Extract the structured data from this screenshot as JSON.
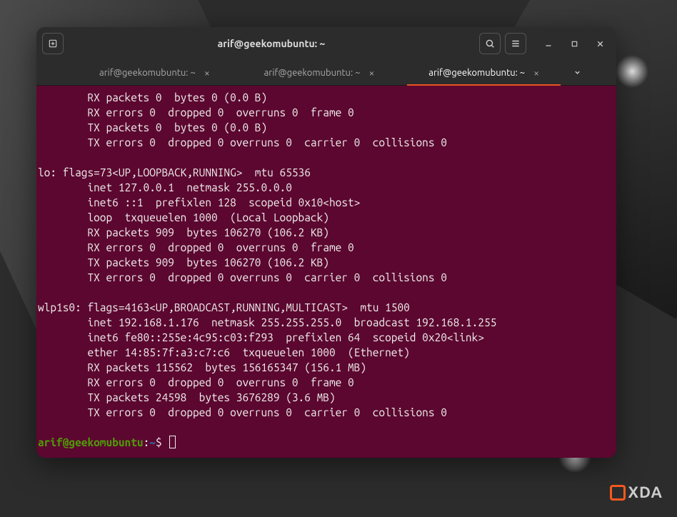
{
  "window": {
    "title": "arif@geekomubuntu: ~"
  },
  "tabs": {
    "items": [
      {
        "label": "arif@geekomubuntu: ~"
      },
      {
        "label": "arif@geekomubuntu: ~"
      },
      {
        "label": "arif@geekomubuntu: ~"
      }
    ]
  },
  "output": {
    "top": "        RX packets 0  bytes 0 (0.0 B)\n        RX errors 0  dropped 0  overruns 0  frame 0\n        TX packets 0  bytes 0 (0.0 B)\n        TX errors 0  dropped 0 overruns 0  carrier 0  collisions 0\n",
    "lo": "lo: flags=73<UP,LOOPBACK,RUNNING>  mtu 65536\n        inet 127.0.0.1  netmask 255.0.0.0\n        inet6 ::1  prefixlen 128  scopeid 0x10<host>\n        loop  txqueuelen 1000  (Local Loopback)\n        RX packets 909  bytes 106270 (106.2 KB)\n        RX errors 0  dropped 0  overruns 0  frame 0\n        TX packets 909  bytes 106270 (106.2 KB)\n        TX errors 0  dropped 0 overruns 0  carrier 0  collisions 0\n",
    "wlp1s0": "wlp1s0: flags=4163<UP,BROADCAST,RUNNING,MULTICAST>  mtu 1500\n        inet 192.168.1.176  netmask 255.255.255.0  broadcast 192.168.1.255\n        inet6 fe80::255e:4c95:c03:f293  prefixlen 64  scopeid 0x20<link>\n        ether 14:85:7f:a3:c7:c6  txqueuelen 1000  (Ethernet)\n        RX packets 115562  bytes 156165347 (156.1 MB)\n        RX errors 0  dropped 0  overruns 0  frame 0\n        TX packets 24598  bytes 3676289 (3.6 MB)\n        TX errors 0  dropped 0 overruns 0  carrier 0  collisions 0\n"
  },
  "prompt": {
    "user": "arif@geekomubuntu",
    "sep": ":",
    "path": "~",
    "symbol": "$"
  },
  "watermark": {
    "text": "XDA"
  }
}
